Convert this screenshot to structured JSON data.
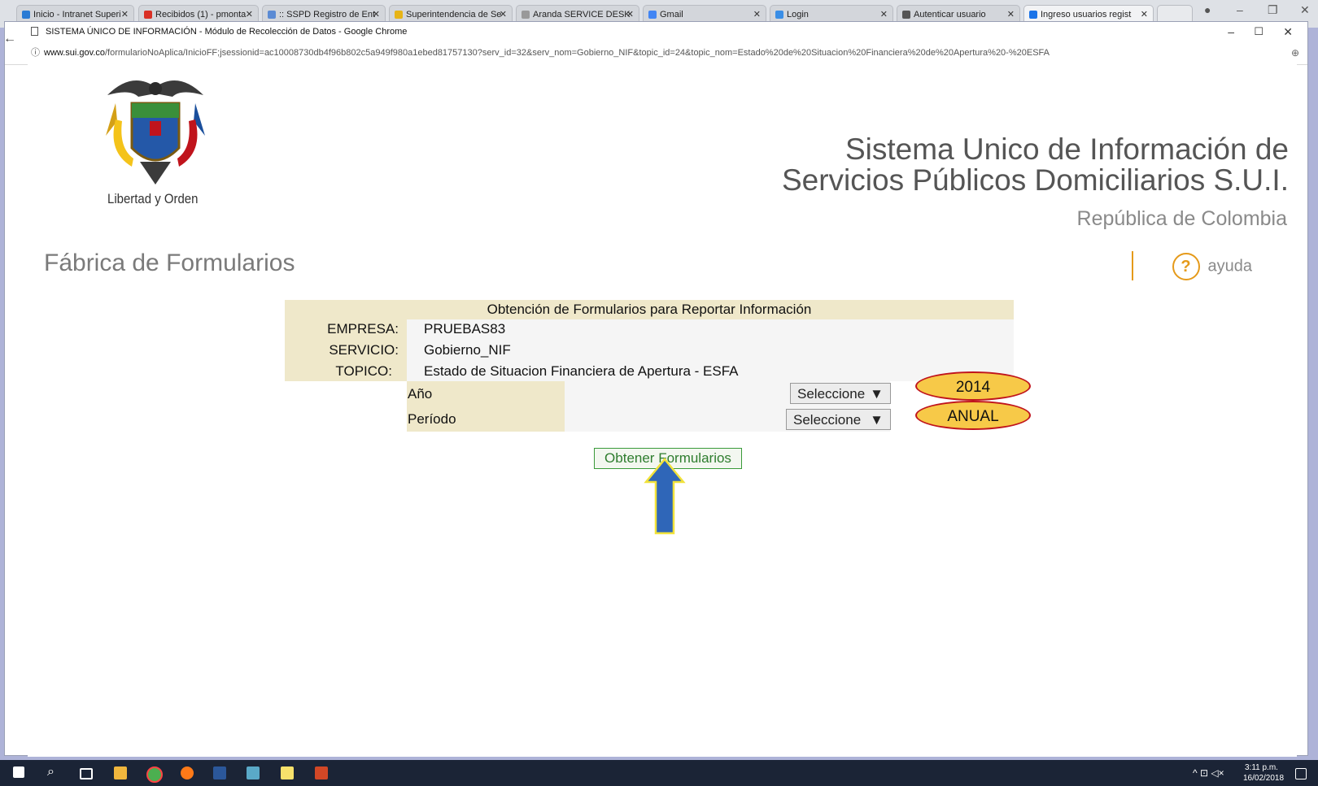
{
  "browser": {
    "tabs": [
      {
        "label": "Inicio - Intranet Superi",
        "color": "#2a7bd4"
      },
      {
        "label": "Recibidos (1) - pmonta",
        "color": "#d93025"
      },
      {
        "label": ":: SSPD Registro de Ent",
        "color": "#5b8bd4"
      },
      {
        "label": "Superintendencia de Se",
        "color": "#e7b416"
      },
      {
        "label": "Aranda SERVICE DESK",
        "color": "#999999"
      },
      {
        "label": "Gmail",
        "color": "#4285f4"
      },
      {
        "label": "Login",
        "color": "#3a8ee6"
      },
      {
        "label": "Autenticar usuario",
        "color": "#555555"
      },
      {
        "label": "Ingreso usuarios regist",
        "color": "#1a73e8"
      }
    ],
    "inner_title": "SISTEMA ÚNICO DE INFORMACIÓN - Módulo de Recolección de Datos - Google Chrome",
    "url_host": "www.sui.gov.co",
    "url_path": "/formularioNoAplica/InicioFF;jsessionid=ac10008730db4f96b802c5a949f980a1ebed81757130?serv_id=32&serv_nom=Gobierno_NIF&topic_id=24&topic_nom=Estado%20de%20Situacion%20Financiera%20de%20Apertura%20-%20ESFA"
  },
  "header": {
    "motto": "Libertad y Orden",
    "system_title_line1": "Sistema Unico de Información de",
    "system_title_line2": "Servicios Públicos Domiciliarios S.U.I.",
    "country": "República de Colombia",
    "page_title": "Fábrica de Formularios",
    "help_label": "ayuda"
  },
  "form": {
    "heading": "Obtención de Formularios para Reportar Información",
    "empresa_label": "EMPRESA:",
    "empresa_value": "PRUEBAS83",
    "servicio_label": "SERVICIO:",
    "servicio_value": "Gobierno_NIF",
    "topico_label": "TOPICO:",
    "topico_value": "Estado de Situacion Financiera de Apertura - ESFA",
    "anio_label": "Año",
    "anio_select": "Seleccione",
    "periodo_label": "Período",
    "periodo_select": "Seleccione",
    "submit_label": "Obtener Formularios"
  },
  "annotations": {
    "anio_value": "2014",
    "periodo_value": "ANUAL"
  },
  "taskbar": {
    "time": "3:11 p.m.",
    "date": "16/02/2018"
  }
}
